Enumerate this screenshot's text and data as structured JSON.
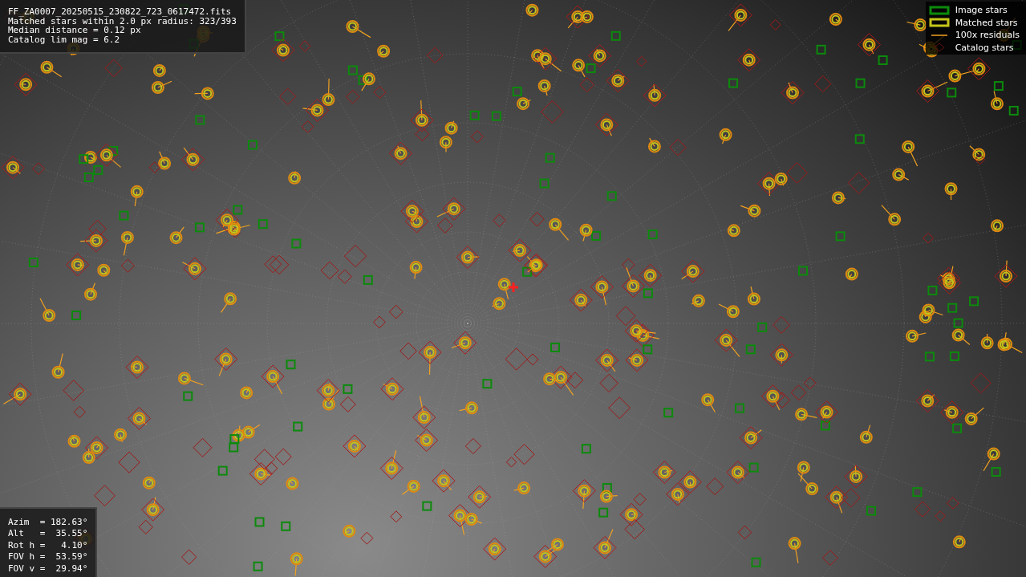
{
  "header": {
    "lines": [
      "FF_ZA0007_20250515_230822_723_0617472.fits",
      "Matched stars within 2.0 px radius: 323/393",
      "Median distance = 0.12 px",
      "Catalog lim mag = 6.2"
    ]
  },
  "legend": [
    {
      "kind": "image",
      "label": "Image stars"
    },
    {
      "kind": "matched",
      "label": "Matched stars"
    },
    {
      "kind": "residual",
      "label": "100x residuals"
    },
    {
      "kind": "catalog",
      "label": "Catalog stars"
    }
  ],
  "pointing": {
    "lines": [
      "Azim  = 182.63°",
      "Alt   =  35.55°",
      "Rot h =   4.10°",
      "FOV h =  53.59°",
      "FOV v =  29.94°"
    ]
  }
}
